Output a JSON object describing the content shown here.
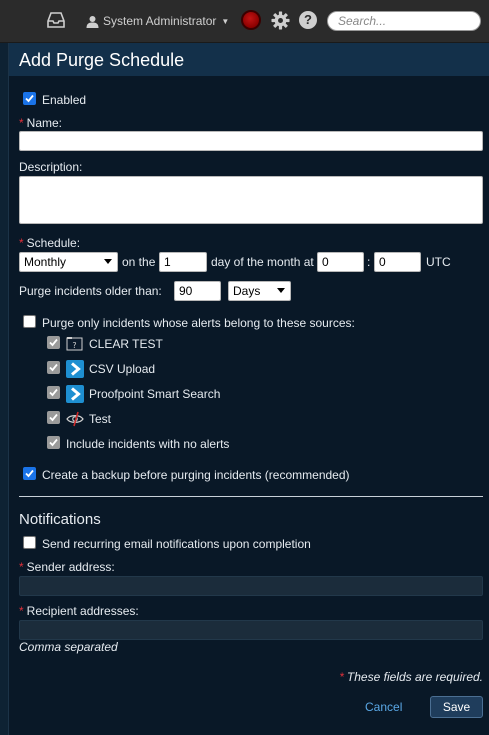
{
  "topbar": {
    "user_name": "System Administrator",
    "search_placeholder": "Search..."
  },
  "dialog": {
    "title": "Add Purge Schedule",
    "enabled_label": "Enabled",
    "name_label": "Name:",
    "name_value": "",
    "description_label": "Description:",
    "description_value": "",
    "schedule_label": "Schedule:",
    "schedule_frequency": "Monthly",
    "on_the_text": "on the",
    "day_value": "1",
    "day_of_month_text": "day of the month at",
    "hour_value": "0",
    "time_separator": ":",
    "minute_value": "0",
    "timezone_text": "UTC",
    "purge_older_label": "Purge incidents older than:",
    "purge_older_value": "90",
    "purge_older_unit": "Days",
    "sources_only_label": "Purge only incidents whose alerts belong to these sources:",
    "sources": [
      {
        "label": "CLEAR TEST"
      },
      {
        "label": "CSV Upload"
      },
      {
        "label": "Proofpoint Smart Search"
      },
      {
        "label": "Test"
      }
    ],
    "include_no_alerts_label": "Include incidents with no alerts",
    "backup_label": "Create a backup before purging incidents (recommended)",
    "notifications_title": "Notifications",
    "send_notifications_label": "Send recurring email notifications upon completion",
    "sender_label": "Sender address:",
    "sender_value": "",
    "recipient_label": "Recipient addresses:",
    "recipient_value": "",
    "recipient_hint": "Comma separated",
    "required_note": "These fields are required.",
    "required_marker": "*",
    "cancel_label": "Cancel",
    "save_label": "Save"
  },
  "colors": {
    "dialog_bg": "#091827",
    "header_bg": "#13304a",
    "accent_blue": "#1a73e8",
    "link_blue": "#5aa8e6",
    "required_red": "#e0303a",
    "status_red": "#c21414"
  },
  "icons": {
    "inbox": "inbox-icon",
    "user": "user-icon",
    "status": "status-indicator-icon",
    "gear": "gear-icon",
    "help": "help-icon"
  }
}
